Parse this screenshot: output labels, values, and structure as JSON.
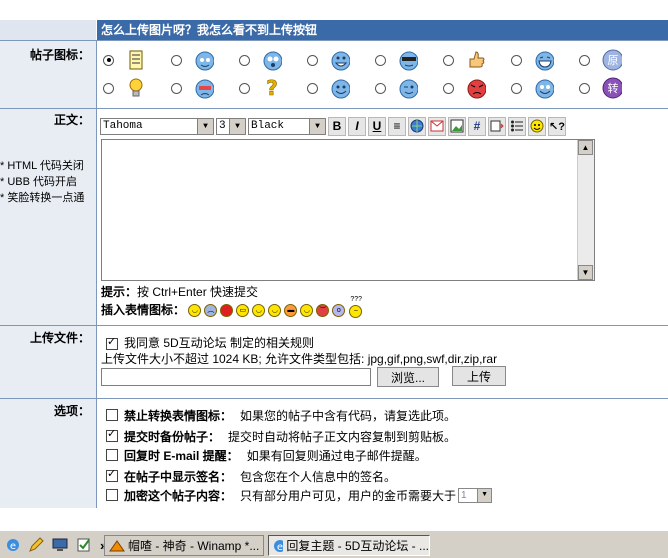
{
  "header": {
    "title": "怎么上传图片呀？我怎么看不到上传按钮"
  },
  "labels": {
    "icon": "帖子图标：",
    "body": "正文：",
    "upload": "上传文件：",
    "options": "选项："
  },
  "side_notes": [
    "* HTML 代码关闭",
    "* UBB  代码开启",
    "* 笑脸转换一点通"
  ],
  "editor": {
    "font": "Tahoma",
    "size": "3",
    "color": "Black",
    "buttons": [
      "B",
      "I",
      "U"
    ],
    "hint_label": "提示：",
    "hint_text": "按 Ctrl+Enter 快速提交",
    "emote_label": "插入表情图标：",
    "emote_last": "???"
  },
  "icon_options": {
    "selected": 0,
    "badges": [
      "原",
      "转"
    ]
  },
  "upload": {
    "agree_text": "我同意 5D互动论坛 制定的相关规则",
    "limit_text": "上传文件大小不超过  1024 KB; 允许文件类型包括: jpg,gif,png,swf,dir,zip,rar",
    "browse": "浏览...",
    "submit": "上传"
  },
  "options": [
    {
      "label": "禁止转换表情图标：",
      "desc": "如果您的帖子中含有代码，请复选此项。",
      "checked": false
    },
    {
      "label": "提交时备份帖子：",
      "desc": "提交时自动将帖子正文内容复制到剪贴板。",
      "checked": true
    },
    {
      "label": "回复时  E-mail 提醒：",
      "desc": "如果有回复则通过电子邮件提醒。",
      "checked": false
    },
    {
      "label": "在帖子中显示签名：",
      "desc": "包含您在个人信息中的签名。",
      "checked": true
    },
    {
      "label": "加密这个帖子内容：",
      "desc": "只有部分用户可见，用户的金币需要大于",
      "checked": false
    }
  ],
  "encrypt_value": "1",
  "taskbar": {
    "chevron": "»",
    "item1": "帽喳  - 神奇 - Winamp *...",
    "item2": "回复主题 - 5D互动论坛 - ..."
  }
}
